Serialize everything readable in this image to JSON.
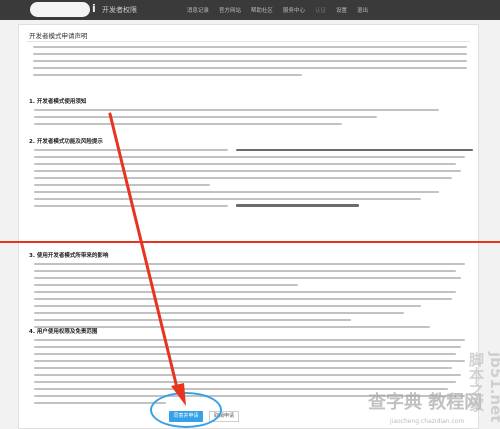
{
  "header": {
    "logo_mark": "i",
    "app_title": "开发者权限",
    "nav": [
      "消息记录",
      "官方网站",
      "帮助社区",
      "服务中心",
      "认证",
      "设置",
      "退出"
    ]
  },
  "panel": {
    "title": "开发者模式申请声明",
    "sections": [
      {
        "id": "s1",
        "title": "1. 开发者模式使用须知"
      },
      {
        "id": "s2",
        "title": "2. 开发者模式功能及风险提示"
      },
      {
        "id": "s3",
        "title": "3. 使用开发者模式所带来的影响"
      },
      {
        "id": "s4",
        "title": "4. 用户使用权限及免责范围"
      }
    ]
  },
  "buttons": {
    "agree": "同意并申请",
    "cancel": "取消申请"
  },
  "watermark": {
    "main": "查字典 教程网",
    "sub": "jiaocheng.chazidian.com",
    "side": "jb51.net 脚本之家"
  },
  "colors": {
    "highlight": "#e8331e",
    "accent": "#35a2e8",
    "header_bg": "#3a3a3a"
  }
}
